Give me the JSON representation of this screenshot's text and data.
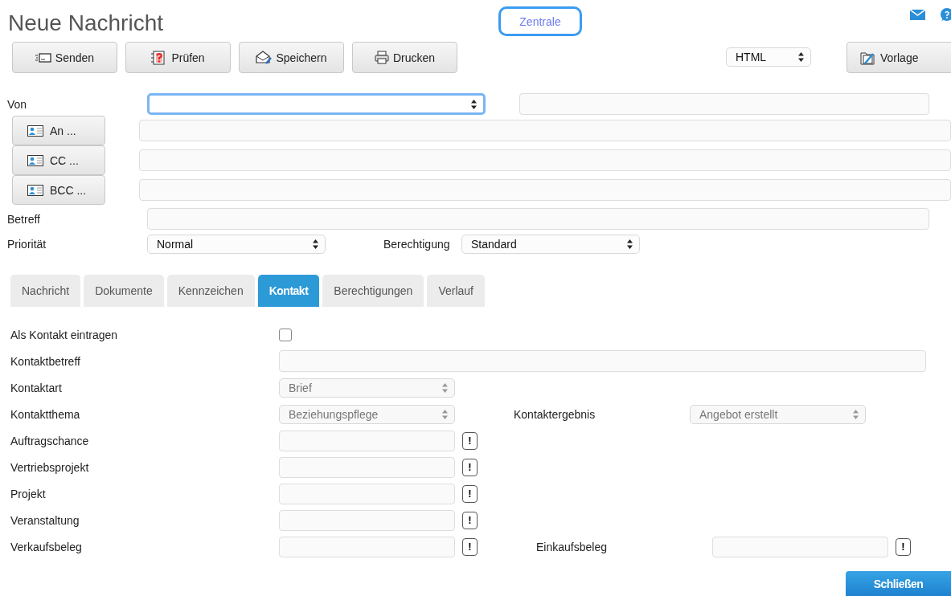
{
  "title": "Neue Nachricht",
  "header_button": "Zentrale",
  "toolbar": {
    "buttons": [
      {
        "label": "Senden"
      },
      {
        "label": "Prüfen"
      },
      {
        "label": "Speichern"
      },
      {
        "label": "Drucken"
      }
    ],
    "format_select": "HTML",
    "template_button": "Vorlage"
  },
  "sender": {
    "label": "Von",
    "focused": true
  },
  "recipients": [
    {
      "label": "An ..."
    },
    {
      "label": "CC ..."
    },
    {
      "label": "BCC ..."
    }
  ],
  "subject_label": "Betreff",
  "priority": {
    "label": "Priorität",
    "value": "Normal"
  },
  "permission": {
    "label": "Berechtigung",
    "value": "Standard"
  },
  "tabs": [
    {
      "label": "Nachricht",
      "selected": false
    },
    {
      "label": "Dokumente",
      "selected": false
    },
    {
      "label": "Kennzeichen",
      "selected": false
    },
    {
      "label": "Kontakt",
      "selected": true
    },
    {
      "label": "Berechtigungen",
      "selected": false
    },
    {
      "label": "Verlauf",
      "selected": false
    }
  ],
  "contact_form": [
    {
      "label": "Als Kontakt eintragen",
      "kind": "checkbox",
      "checked": false
    },
    {
      "label": "Kontaktbetreff",
      "kind": "text"
    },
    {
      "label": "Kontaktart",
      "kind": "select",
      "value": "Brief",
      "disabled": true
    },
    {
      "label": "Kontaktthema",
      "kind": "select",
      "value": "Beziehungspflege",
      "disabled": true,
      "right": {
        "label": "Kontaktergebnis",
        "kind": "select",
        "value": "Angebot erstellt",
        "disabled": true
      }
    },
    {
      "label": "Auftragschance",
      "kind": "lookup",
      "button": "!"
    },
    {
      "label": "Vertriebsprojekt",
      "kind": "lookup",
      "button": "!"
    },
    {
      "label": "Projekt",
      "kind": "lookup",
      "button": "!"
    },
    {
      "label": "Veranstaltung",
      "kind": "lookup",
      "button": "!"
    },
    {
      "label": "Verkaufsbeleg",
      "kind": "lookup",
      "button": "!",
      "right": {
        "label": "Einkaufsbeleg",
        "kind": "lookup",
        "button": "!"
      }
    }
  ],
  "close_button": "Schließen"
}
